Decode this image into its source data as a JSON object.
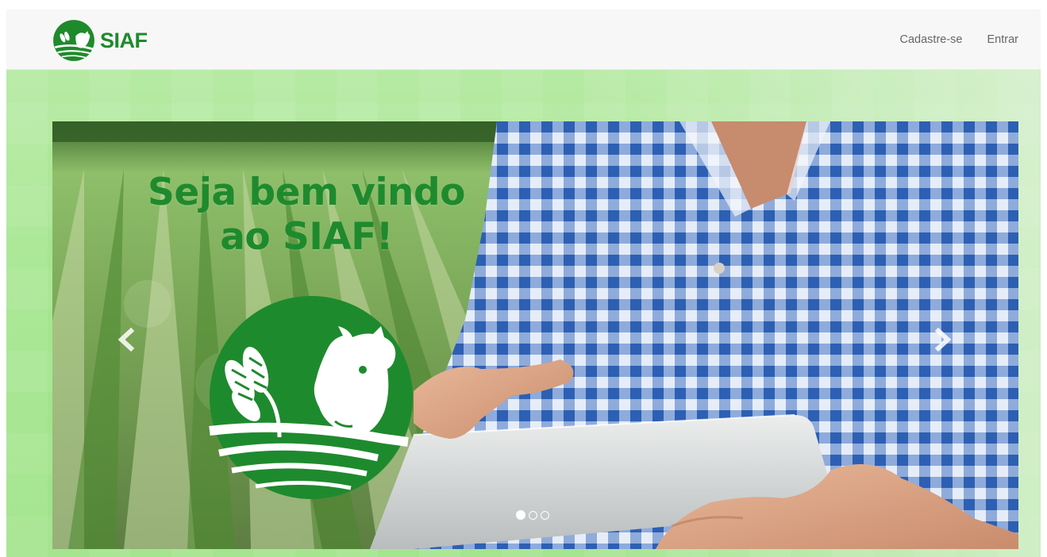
{
  "navbar": {
    "brand_text": "SIAF",
    "links": [
      {
        "label": "Cadastre-se"
      },
      {
        "label": "Entrar"
      }
    ]
  },
  "carousel": {
    "caption_line1": "Seja bem vindo",
    "caption_line2": "ao SIAF!",
    "controls": {
      "prev_icon": "chevron-left-icon",
      "next_icon": "chevron-right-icon"
    },
    "slide_count": 3,
    "active_slide": 1
  },
  "colors": {
    "brand_green": "#1f8a2c",
    "hero_bg": "#a5e68f",
    "shirt_blue": "#2f63b8",
    "nav_bg": "#f7f7f7",
    "nav_link": "#666666"
  }
}
